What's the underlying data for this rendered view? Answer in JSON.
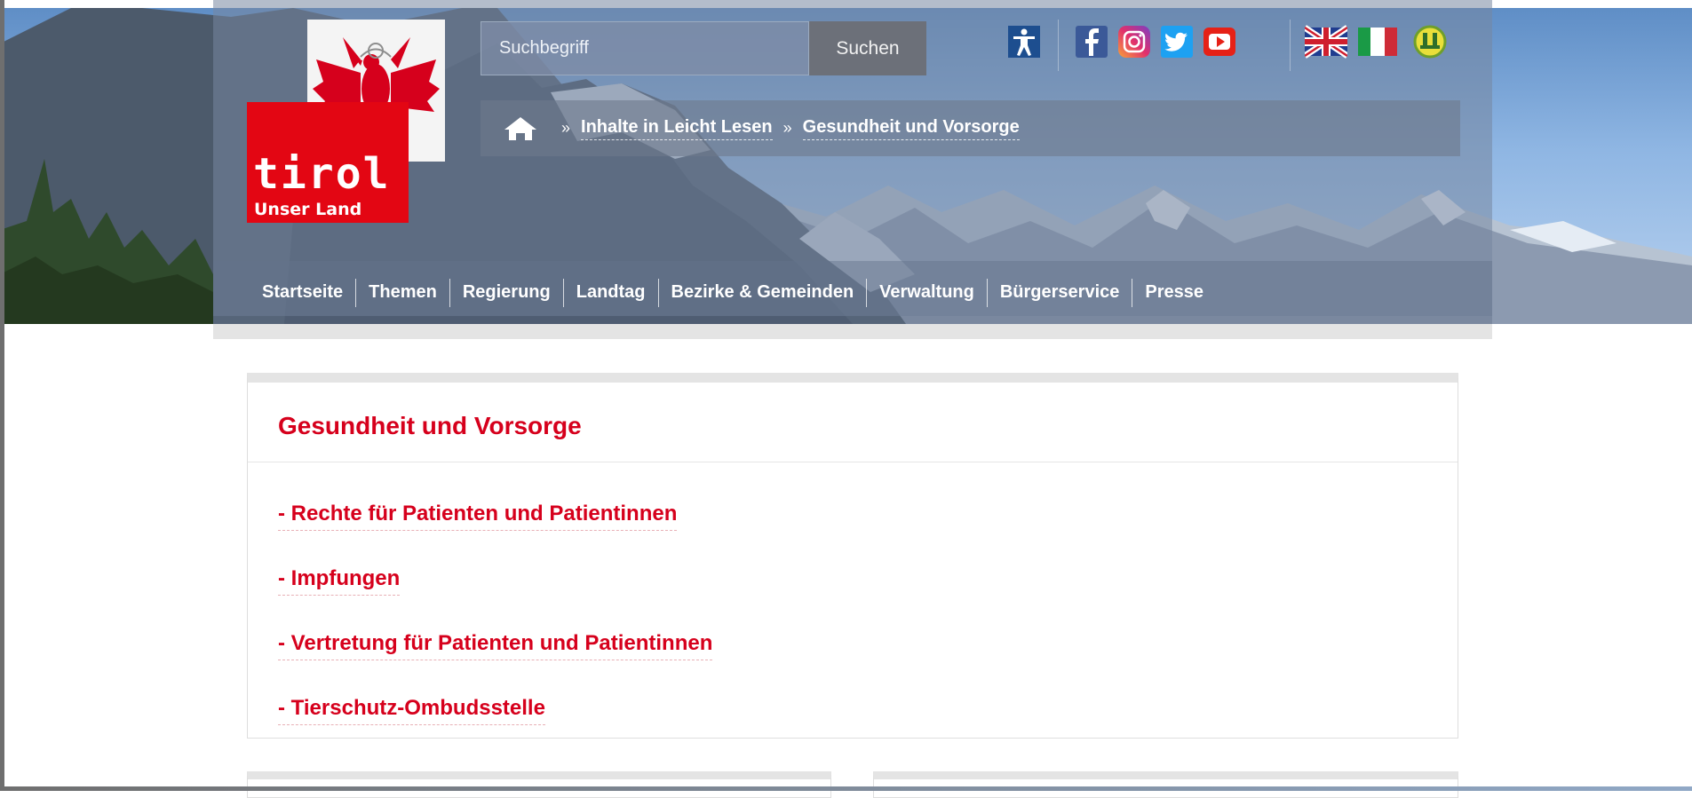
{
  "header": {
    "logo": {
      "wordmark": "tirol",
      "tagline": "Unser Land"
    },
    "search": {
      "placeholder": "Suchbegriff",
      "button_label": "Suchen"
    },
    "icons": [
      "accessibility-icon",
      "facebook-icon",
      "instagram-icon",
      "twitter-icon",
      "youtube-icon",
      "uk-flag-icon",
      "italy-flag-icon",
      "easy-language-icon"
    ],
    "breadcrumb": {
      "home_icon": "home-icon",
      "separator": "»",
      "items": [
        "Inhalte in Leicht Lesen",
        "Gesundheit und Vorsorge"
      ]
    },
    "nav": {
      "items": [
        "Startseite",
        "Themen",
        "Regierung",
        "Landtag",
        "Bezirke & Gemeinden",
        "Verwaltung",
        "Bürgerservice",
        "Presse"
      ]
    }
  },
  "main": {
    "title": "Gesundheit und Vorsorge",
    "links": [
      "- Rechte für Patienten und Patientinnen",
      "- Impfungen",
      "- Vertretung für Patienten und Patientinnen",
      "- Tierschutz-Ombudsstelle"
    ]
  },
  "colors": {
    "brand_red": "#d6001c",
    "logo_red": "#e30613",
    "search_button": "#6c7079"
  }
}
